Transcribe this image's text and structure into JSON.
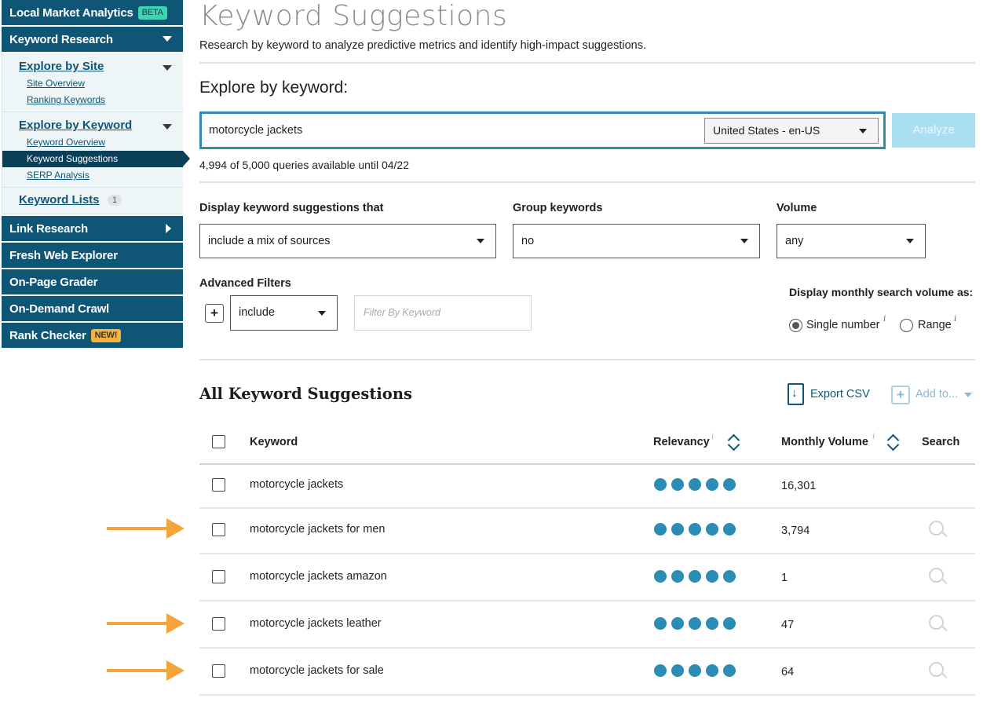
{
  "sidebar": {
    "local_market": {
      "label": "Local Market Analytics",
      "badge": "BETA"
    },
    "keyword_research": {
      "label": "Keyword Research"
    },
    "explore_by_site": {
      "label": "Explore by Site",
      "links": [
        "Site Overview",
        "Ranking Keywords"
      ]
    },
    "explore_by_keyword": {
      "label": "Explore by Keyword",
      "links": [
        "Keyword Overview",
        "Keyword Suggestions",
        "SERP Analysis"
      ]
    },
    "keyword_lists": {
      "label": "Keyword Lists",
      "count": "1"
    },
    "link_research": {
      "label": "Link Research"
    },
    "fresh_web": {
      "label": "Fresh Web Explorer"
    },
    "on_page": {
      "label": "On-Page Grader"
    },
    "on_demand": {
      "label": "On-Demand Crawl"
    },
    "rank_checker": {
      "label": "Rank Checker",
      "badge": "NEW!"
    }
  },
  "main": {
    "title": "Keyword Suggestions",
    "subtitle": "Research by keyword to analyze predictive metrics and identify high-impact suggestions.",
    "explore_label": "Explore by keyword:",
    "keyword_value": "motorcycle jackets",
    "locale": "United States - en-US",
    "analyze_label": "Analyze",
    "queries_text": "4,994 of 5,000 queries available until 04/22"
  },
  "filters": {
    "display_label": "Display keyword suggestions that",
    "display_value": "include a mix of sources",
    "group_label": "Group keywords",
    "group_value": "no",
    "volume_label": "Volume",
    "volume_value": "any",
    "advanced_label": "Advanced Filters",
    "advanced_mode": "include",
    "filter_placeholder": "Filter By Keyword",
    "monthly_label": "Display monthly search volume as:",
    "radio_single": "Single number",
    "radio_range": "Range",
    "selected_radio": "single"
  },
  "results": {
    "title": "All Keyword Suggestions",
    "export_label": "Export CSV",
    "add_label": "Add to...",
    "columns": {
      "keyword": "Keyword",
      "relevancy": "Relevancy",
      "volume": "Monthly Volume",
      "search": "Search"
    },
    "rows": [
      {
        "keyword": "motorcycle jackets",
        "relevancy": 5,
        "volume": "16,301",
        "highlighted": false
      },
      {
        "keyword": "motorcycle jackets for men",
        "relevancy": 5,
        "volume": "3,794",
        "highlighted": true
      },
      {
        "keyword": "motorcycle jackets amazon",
        "relevancy": 5,
        "volume": "1",
        "highlighted": false
      },
      {
        "keyword": "motorcycle jackets leather",
        "relevancy": 5,
        "volume": "47",
        "highlighted": true
      },
      {
        "keyword": "motorcycle jackets for sale",
        "relevancy": 5,
        "volume": "64",
        "highlighted": true
      }
    ]
  },
  "colors": {
    "nav": "#0f5676",
    "accent": "#2b8db5",
    "highlight_arrow": "#f3a53b"
  }
}
